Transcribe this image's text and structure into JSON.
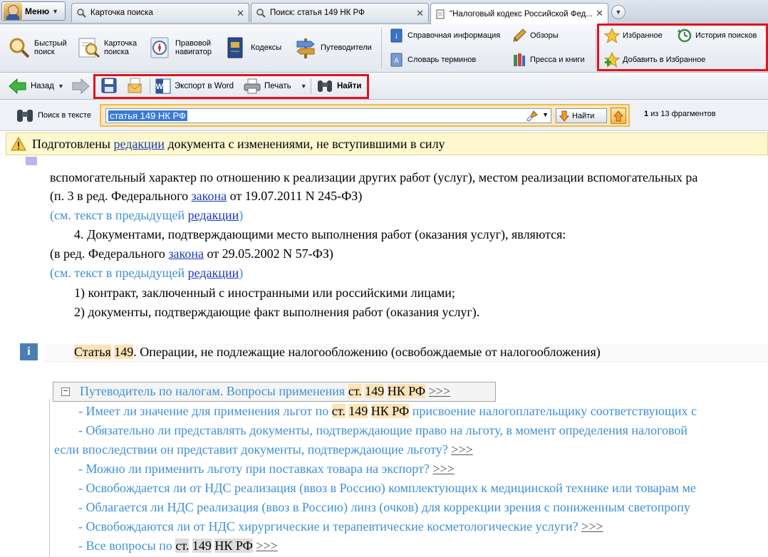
{
  "menu": {
    "label": "Меню"
  },
  "tabs": [
    {
      "label": "Карточка поиска"
    },
    {
      "label": "Поиск: статья 149 НК РФ"
    },
    {
      "label": "\"Налоговый кодекс Российской Фед..."
    }
  ],
  "toolbar": {
    "quick_search": [
      "Быстрый",
      "поиск"
    ],
    "search_card": [
      "Карточка",
      "поиска"
    ],
    "legal_navigator": [
      "Правовой",
      "навигатор"
    ],
    "codes": "Кодексы",
    "guides": "Путеводители",
    "reference_info": "Справочная информация",
    "reviews": "Обзоры",
    "glossary": "Словарь терминов",
    "press_books": "Пресса и книги",
    "favorites": "Избранное",
    "search_history": "История поисков",
    "add_favorites": "Добавить в Избранное"
  },
  "nav": {
    "back": "Назад",
    "export_word": "Экспорт в Word",
    "print": "Печать",
    "find": "Найти"
  },
  "search_row": {
    "label": "Поиск в тексте",
    "query": "статья 149 НК РФ",
    "find": "Найти",
    "count": "1",
    "count_suffix": "из 13 фрагментов"
  },
  "warning": {
    "pre": "Подготовлены ",
    "link": "редакции",
    "post": " документа с изменениями, не вступившими в силу"
  },
  "doc": {
    "l0": "вспомогательный характер по отношению к реализации других работ (услуг), местом реализации вспомогательных ра",
    "l1_pre": "(п. 3 в ред. Федерального ",
    "l1_link": "закона",
    "l1_post": " от 19.07.2011 N 245-ФЗ)",
    "see_pre": "(см. текст в предыдущей ",
    "see_link": "редакции",
    "see_post": ")",
    "l3": "4. Документами, подтверждающими место выполнения работ (оказания услуг), являются:",
    "l4_pre": "(в ред. Федерального ",
    "l4_link": "закона",
    "l4_post": " от 29.05.2002 N 57-ФЗ)",
    "l6": "1) контракт, заключенный с иностранными или российскими лицами;",
    "l7": "2) документы, подтверждающие факт выполнения работ (оказания услуг).",
    "art_word": "Статья",
    "art_num": "149",
    "art_title": ". Операции, не подлежащие налогообложению (освобождаемые от налогообложения)",
    "guide_pre": "Путеводитель по налогам. Вопросы применения ",
    "st": "ст.",
    "dot": ".",
    "num": "149",
    "nk": "НК РФ",
    "more": ">>>",
    "q1_pre": "- Имеет ли значение для применения льгот по ",
    "q1_post": " присвоение налогоплательщику соответствующих с",
    "q2": "- Обязательно ли представлять документы, подтверждающие право на льготу, в момент определения налоговой",
    "q2b": "если впоследствии он представит документы, подтверждающие льготу? ",
    "q3": "- Можно ли применить льготу при поставках товара на экспорт? ",
    "q4": "- Освобождается ли от НДС реализация (ввоз в Россию) комплектующих к медицинской технике или товарам ме",
    "q5": "- Облагается ли НДС реализация (ввоз в Россию) линз (очков) для коррекции зрения с пониженным светопропу",
    "q6": "- Освобождаются ли от НДС хирургические и терапевтические косметологические услуги? ",
    "q7_pre": "- Все вопросы по "
  }
}
